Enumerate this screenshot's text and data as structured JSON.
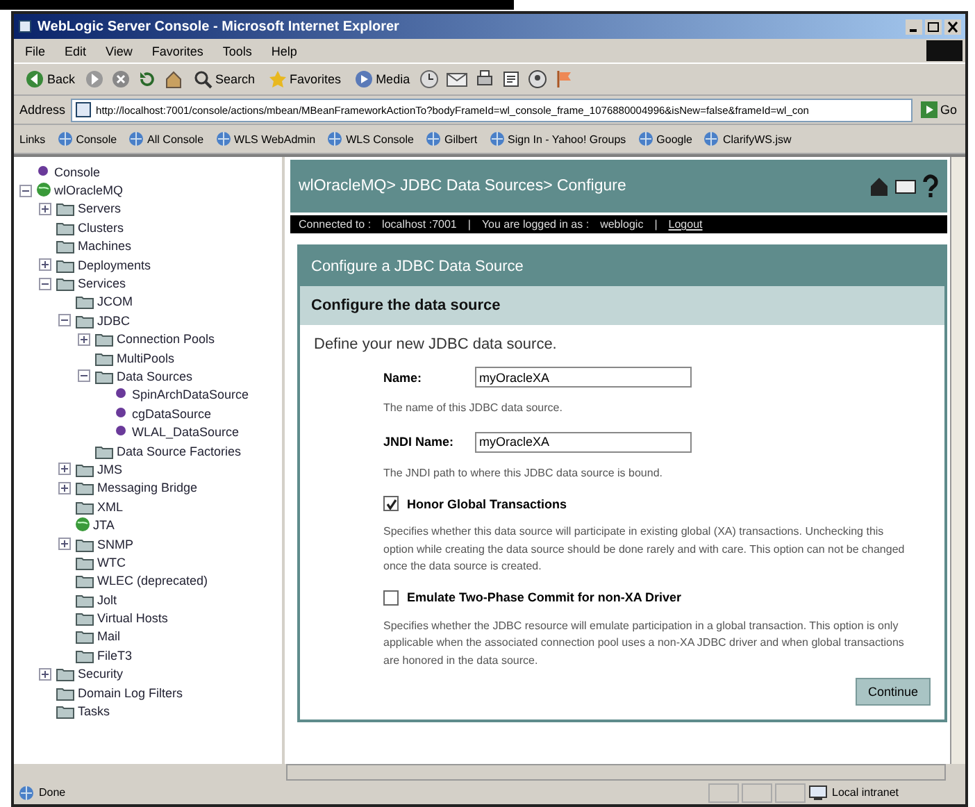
{
  "window": {
    "title": "WebLogic Server Console - Microsoft Internet Explorer"
  },
  "menu": [
    "File",
    "Edit",
    "View",
    "Favorites",
    "Tools",
    "Help"
  ],
  "toolbar": [
    {
      "label": "Back",
      "kind": "back"
    },
    {
      "label": "Search",
      "kind": "search"
    },
    {
      "label": "Favorites",
      "kind": "favorites"
    },
    {
      "label": "Media",
      "kind": "media"
    }
  ],
  "address": {
    "label": "Address",
    "value": "http://localhost:7001/console/actions/mbean/MBeanFrameworkActionTo?bodyFrameId=wl_console_frame_1076880004996&isNew=false&frameId=wl_con",
    "go": "Go"
  },
  "links": {
    "label": "Links",
    "items": [
      "Console",
      "All Console",
      "WLS WebAdmin",
      "WLS Console",
      "Gilbert",
      "Sign In - Yahoo! Groups",
      "Google",
      "ClarifyWS.jsw"
    ]
  },
  "tree": [
    {
      "label": "Console",
      "kind": "bullet"
    },
    {
      "label": "wlOracleMQ",
      "kind": "globe",
      "expanded": true,
      "children": [
        {
          "label": "Servers",
          "kind": "folder",
          "expanded": false
        },
        {
          "label": "Clusters",
          "kind": "folder"
        },
        {
          "label": "Machines",
          "kind": "folder"
        },
        {
          "label": "Deployments",
          "kind": "folder",
          "expanded": false
        },
        {
          "label": "Services",
          "kind": "folder",
          "expanded": true,
          "children": [
            {
              "label": "JCOM",
              "kind": "folder"
            },
            {
              "label": "JDBC",
              "kind": "folder",
              "expanded": true,
              "children": [
                {
                  "label": "Connection Pools",
                  "kind": "folder",
                  "expanded": false
                },
                {
                  "label": "MultiPools",
                  "kind": "folder"
                },
                {
                  "label": "Data Sources",
                  "kind": "folder",
                  "expanded": true,
                  "children": [
                    {
                      "label": "SpinArchDataSource",
                      "kind": "bullet"
                    },
                    {
                      "label": "cgDataSource",
                      "kind": "bullet"
                    },
                    {
                      "label": "WLAL_DataSource",
                      "kind": "bullet"
                    }
                  ]
                },
                {
                  "label": "Data Source Factories",
                  "kind": "folder"
                }
              ]
            },
            {
              "label": "JMS",
              "kind": "folder",
              "expanded": false
            },
            {
              "label": "Messaging Bridge",
              "kind": "folder",
              "expanded": false
            },
            {
              "label": "XML",
              "kind": "folder"
            },
            {
              "label": "JTA",
              "kind": "globe"
            },
            {
              "label": "SNMP",
              "kind": "folder",
              "expanded": false
            },
            {
              "label": "WTC",
              "kind": "folder"
            },
            {
              "label": "WLEC (deprecated)",
              "kind": "folder"
            },
            {
              "label": "Jolt",
              "kind": "folder"
            },
            {
              "label": "Virtual Hosts",
              "kind": "folder"
            },
            {
              "label": "Mail",
              "kind": "folder"
            },
            {
              "label": "FileT3",
              "kind": "folder"
            }
          ]
        },
        {
          "label": "Security",
          "kind": "folder",
          "expanded": false
        },
        {
          "label": "Domain Log Filters",
          "kind": "folder"
        },
        {
          "label": "Tasks",
          "kind": "folder"
        }
      ]
    }
  ],
  "header": {
    "breadcrumb": "wlOracleMQ> JDBC Data Sources> Configure",
    "connected_label": "Connected to :",
    "host": "localhost :7001",
    "separators": [
      "|",
      "|"
    ],
    "logged_label": "You are logged in as :",
    "user": "weblogic",
    "logout": "Logout"
  },
  "panel": {
    "title": "Configure a JDBC Data Source",
    "subtitle": "Configure the data source",
    "intro": "Define your new JDBC data source.",
    "fields": [
      {
        "label": "Name:",
        "value": "myOracleXA",
        "help": "The name of this JDBC data source."
      },
      {
        "label": "JNDI Name:",
        "value": "myOracleXA",
        "help": "The JNDI path to where this JDBC data source is bound."
      }
    ],
    "options": [
      {
        "label": "Honor Global Transactions",
        "checked": true,
        "help": "Specifies whether this data source will participate in existing global (XA) transactions. Unchecking this option while creating the data source should be done rarely and with care. This option can not be changed once the data source is created."
      },
      {
        "label": "Emulate Two-Phase Commit for non-XA Driver",
        "checked": false,
        "help": "Specifies whether the JDBC resource will emulate participation in a global transaction. This option is only applicable when the associated connection pool uses a non-XA JDBC driver and when global transactions are honored in the data source."
      }
    ],
    "button": "Continue"
  },
  "status_bar": {
    "text": "Done",
    "zone": "Local intranet"
  }
}
